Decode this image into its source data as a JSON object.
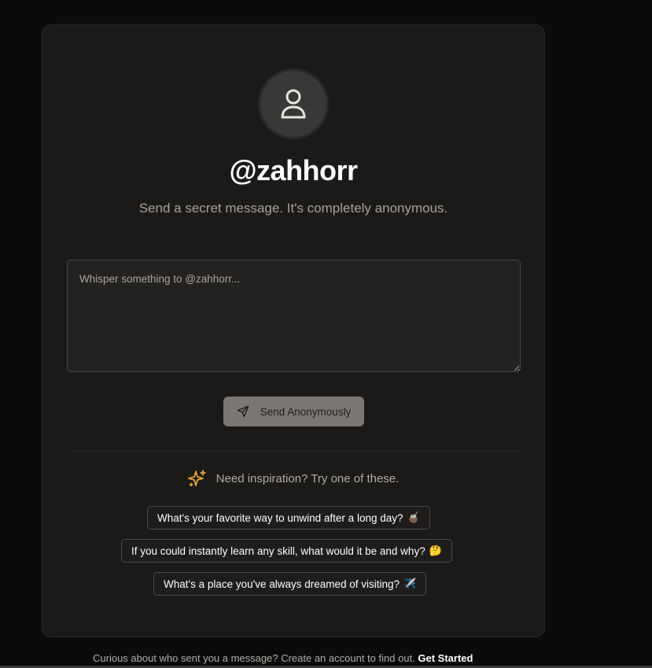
{
  "profile": {
    "username": "@zahhorr",
    "subtitle": "Send a secret message. It's completely anonymous.",
    "avatar_icon": "user-icon"
  },
  "message": {
    "placeholder": "Whisper something to @zahhorr...",
    "value": ""
  },
  "send_button": {
    "label": "Send Anonymously",
    "icon": "send-icon"
  },
  "inspiration": {
    "label": "Need inspiration? Try one of these.",
    "icon": "sparkles-icon",
    "icon_color": "#e6a23c",
    "suggestions": [
      {
        "text": "What's your favorite way to unwind after a long day?",
        "emoji": "🧉"
      },
      {
        "text": "If you could instantly learn any skill, what would it be and why?",
        "emoji": "🤔"
      },
      {
        "text": "What's a place you've always dreamed of visiting?",
        "emoji": "✈️"
      }
    ]
  },
  "footer": {
    "text": "Curious about who sent you a message? Create an account to find out.",
    "link": "Get Started"
  }
}
